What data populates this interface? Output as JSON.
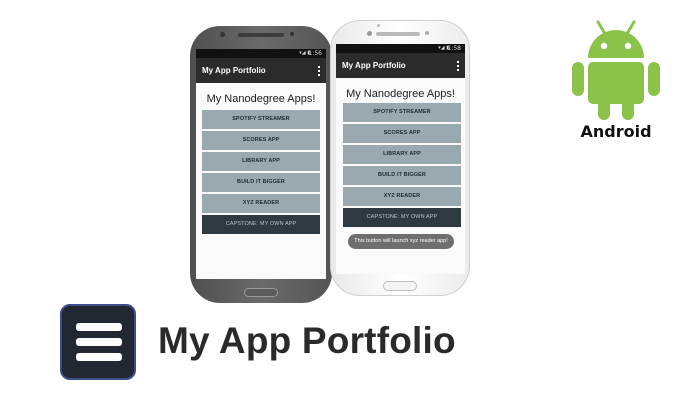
{
  "phones": [
    {
      "variant": "dark",
      "status_time": "1:56",
      "status_icons": "▾◢ ▮",
      "app_title": "My App Portfolio",
      "heading": "My Nanodegree Apps!",
      "buttons": [
        "SPOTIFY STREAMER",
        "SCORES APP",
        "LIBRARY APP",
        "BUILD IT BIGGER",
        "XYZ READER",
        "CAPSTONE: MY OWN APP"
      ]
    },
    {
      "variant": "light",
      "status_time": "1:58",
      "status_icons": "▾◢ ▮",
      "app_title": "My App Portfolio",
      "heading": "My Nanodegree Apps!",
      "buttons": [
        "SPOTIFY STREAMER",
        "SCORES APP",
        "LIBRARY APP",
        "BUILD IT BIGGER",
        "XYZ READER",
        "CAPSTONE: MY OWN APP"
      ],
      "toast": "This button will launch xyz reader app!"
    }
  ],
  "android": {
    "label": "Android",
    "color": "#8bc34a"
  },
  "banner": {
    "title": "My App Portfolio",
    "icon": "menu-icon"
  },
  "colors": {
    "button": "#9aa9b0",
    "button_capstone": "#2f3a40",
    "appbar": "#2b2b2b"
  }
}
